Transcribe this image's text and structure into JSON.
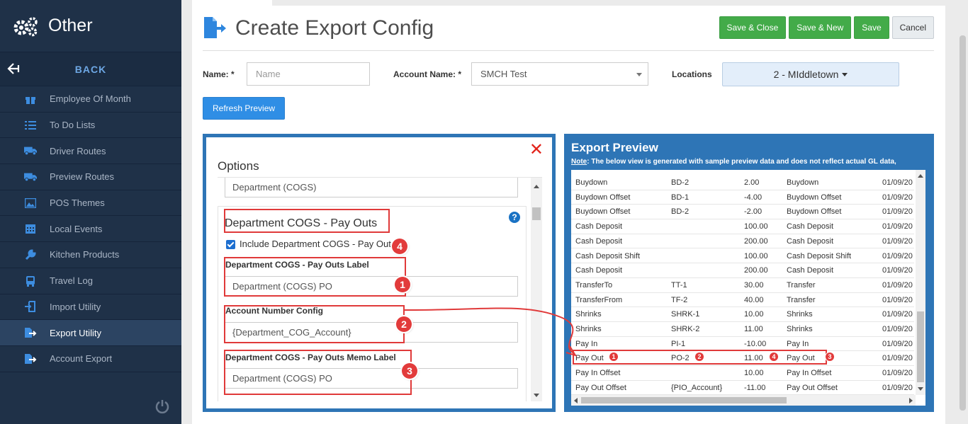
{
  "sidebar": {
    "section_title": "Other",
    "back_label": "BACK",
    "items": [
      {
        "label": "Employee Of Month",
        "icon": "gift-icon"
      },
      {
        "label": "To Do Lists",
        "icon": "list-icon"
      },
      {
        "label": "Driver Routes",
        "icon": "truck-icon"
      },
      {
        "label": "Preview Routes",
        "icon": "truck-icon"
      },
      {
        "label": "POS Themes",
        "icon": "image-icon"
      },
      {
        "label": "Local Events",
        "icon": "calendar-icon"
      },
      {
        "label": "Kitchen Products",
        "icon": "wrench-icon"
      },
      {
        "label": "Travel Log",
        "icon": "bus-icon"
      },
      {
        "label": "Import Utility",
        "icon": "import-icon"
      },
      {
        "label": "Export Utility",
        "icon": "export-icon",
        "active": true
      },
      {
        "label": "Account Export",
        "icon": "export-icon"
      }
    ]
  },
  "header": {
    "title": "Create Export Config",
    "buttons": {
      "save_close": "Save & Close",
      "save_new": "Save & New",
      "save": "Save",
      "cancel": "Cancel"
    }
  },
  "form": {
    "name_label": "Name: *",
    "name_placeholder": "Name",
    "account_label": "Account Name: *",
    "account_value": "SMCH Test",
    "locations_label": "Locations",
    "locations_value": "2 - MIddletown",
    "refresh_label": "Refresh Preview"
  },
  "options": {
    "title": "Options",
    "prev_field_value": "Department (COGS)",
    "section_title": "Department COGS - Pay Outs",
    "include_label": "Include Department COGS - Pay Outs",
    "label_field_label": "Department COGS - Pay Outs Label",
    "label_field_value": "Department (COGS) PO",
    "account_config_label": "Account Number Config",
    "account_config_value": "{Department_COG_Account}",
    "memo_label": "Department COGS - Pay Outs Memo Label",
    "memo_value": "Department (COGS) PO"
  },
  "preview": {
    "title": "Export Preview",
    "note_bold": "Note",
    "note_text": ": The below view is generated with sample preview data and does not reflect actual GL data,",
    "rows": [
      {
        "c1": "Buydown",
        "c2": "BD-2",
        "c3": "2.00",
        "c4": "Buydown",
        "c5": "01/09/20"
      },
      {
        "c1": "Buydown Offset",
        "c2": "BD-1",
        "c3": "-4.00",
        "c4": "Buydown Offset",
        "c5": "01/09/20"
      },
      {
        "c1": "Buydown Offset",
        "c2": "BD-2",
        "c3": "-2.00",
        "c4": "Buydown Offset",
        "c5": "01/09/20"
      },
      {
        "c1": "Cash Deposit",
        "c2": "",
        "c3": "100.00",
        "c4": "Cash Deposit",
        "c5": "01/09/20"
      },
      {
        "c1": "Cash Deposit",
        "c2": "",
        "c3": "200.00",
        "c4": "Cash Deposit",
        "c5": "01/09/20"
      },
      {
        "c1": "Cash Deposit Shift",
        "c2": "",
        "c3": "100.00",
        "c4": "Cash Deposit Shift",
        "c5": "01/09/20"
      },
      {
        "c1": "Cash Deposit",
        "c2": "",
        "c3": "200.00",
        "c4": "Cash Deposit",
        "c5": "01/09/20"
      },
      {
        "c1": "TransferTo",
        "c2": "TT-1",
        "c3": "30.00",
        "c4": "Transfer",
        "c5": "01/09/20"
      },
      {
        "c1": "TransferFrom",
        "c2": "TF-2",
        "c3": "40.00",
        "c4": "Transfer",
        "c5": "01/09/20"
      },
      {
        "c1": "Shrinks",
        "c2": "SHRK-1",
        "c3": "10.00",
        "c4": "Shrinks",
        "c5": "01/09/20"
      },
      {
        "c1": "Shrinks",
        "c2": "SHRK-2",
        "c3": "11.00",
        "c4": "Shrinks",
        "c5": "01/09/20"
      },
      {
        "c1": "Pay In",
        "c2": "PI-1",
        "c3": "-10.00",
        "c4": "Pay In",
        "c5": "01/09/20"
      },
      {
        "c1": "Pay Out",
        "c2": "PO-2",
        "c3": "11.00",
        "c4": "Pay Out",
        "c5": "01/09/20"
      },
      {
        "c1": "Pay In Offset",
        "c2": "",
        "c3": "10.00",
        "c4": "Pay In Offset",
        "c5": "01/09/20"
      },
      {
        "c1": "Pay Out Offset",
        "c2": "{PIO_Account}",
        "c3": "-11.00",
        "c4": "Pay Out Offset",
        "c5": "01/09/20"
      }
    ]
  },
  "annotations": {
    "b1": "1",
    "b2": "2",
    "b3": "3",
    "b4": "4"
  },
  "colors": {
    "accent": "#2e75b6",
    "save_green": "#43ab49",
    "annotation_red": "#e03a3a"
  }
}
